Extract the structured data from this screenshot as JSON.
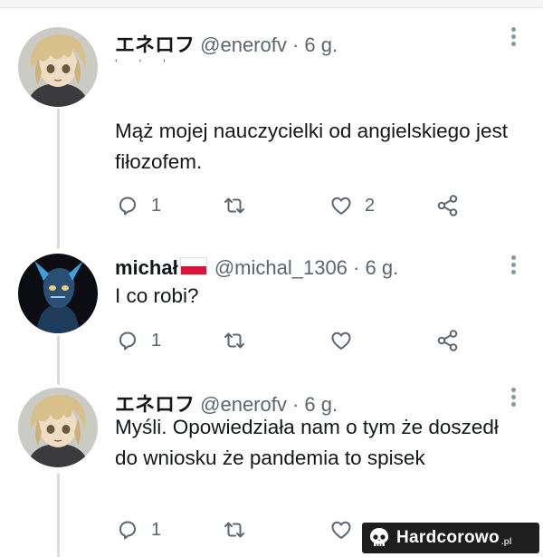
{
  "tweets": [
    {
      "display_name": "エネロフ",
      "handle": "@enerofv",
      "time": "· 6 g.",
      "garbled": "' ' '",
      "text": "Mąż mojej nauczycielki od angielskiego jest fiłozofem.",
      "replies": "1",
      "retweets": "",
      "likes": "2"
    },
    {
      "display_name": "michał",
      "handle": "@michal_1306",
      "time": "· 6 g.",
      "text": "I co robi?",
      "replies": "1",
      "retweets": "",
      "likes": ""
    },
    {
      "display_name": "エネロフ",
      "handle": "@enerofv",
      "time": "· 6 g.",
      "text": "Myśli. Opowiedziała nam o tym że doszedł do wniosku że pandemia to spisek",
      "replies": "1",
      "retweets": "",
      "likes": ""
    }
  ],
  "icons": {
    "reply": "reply-icon",
    "retweet": "retweet-icon",
    "like": "heart-icon",
    "share": "share-icon",
    "more": "more-icon"
  },
  "colors": {
    "text": "#14171a",
    "muted": "#5b6670",
    "thread_line": "#d8dde2",
    "flag_white": "#ffffff",
    "flag_red": "#dc143c"
  },
  "watermark": {
    "brand": "Hardcorowo",
    "tld": ".pl"
  }
}
